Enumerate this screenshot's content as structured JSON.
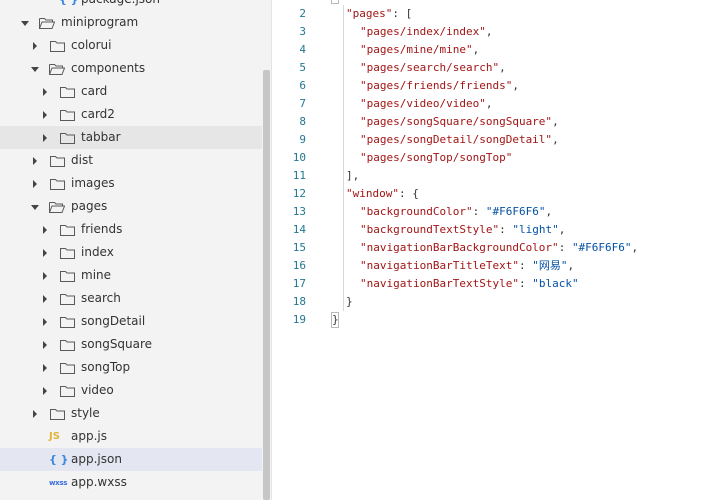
{
  "explorer": {
    "items": [
      {
        "label": "package.json",
        "kind": "file",
        "file_type": "json",
        "depth": 2,
        "badge": "{ }"
      },
      {
        "label": "miniprogram",
        "kind": "folder",
        "expanded": true,
        "depth": 0
      },
      {
        "label": "colorui",
        "kind": "folder",
        "expanded": false,
        "depth": 1
      },
      {
        "label": "components",
        "kind": "folder",
        "expanded": true,
        "depth": 1
      },
      {
        "label": "card",
        "kind": "folder",
        "expanded": false,
        "depth": 2
      },
      {
        "label": "card2",
        "kind": "folder",
        "expanded": false,
        "depth": 2
      },
      {
        "label": "tabbar",
        "kind": "folder",
        "expanded": false,
        "depth": 2,
        "hovered": true
      },
      {
        "label": "dist",
        "kind": "folder",
        "expanded": false,
        "depth": 1
      },
      {
        "label": "images",
        "kind": "folder",
        "expanded": false,
        "depth": 1
      },
      {
        "label": "pages",
        "kind": "folder",
        "expanded": true,
        "depth": 1
      },
      {
        "label": "friends",
        "kind": "folder",
        "expanded": false,
        "depth": 2
      },
      {
        "label": "index",
        "kind": "folder",
        "expanded": false,
        "depth": 2
      },
      {
        "label": "mine",
        "kind": "folder",
        "expanded": false,
        "depth": 2
      },
      {
        "label": "search",
        "kind": "folder",
        "expanded": false,
        "depth": 2
      },
      {
        "label": "songDetail",
        "kind": "folder",
        "expanded": false,
        "depth": 2
      },
      {
        "label": "songSquare",
        "kind": "folder",
        "expanded": false,
        "depth": 2
      },
      {
        "label": "songTop",
        "kind": "folder",
        "expanded": false,
        "depth": 2
      },
      {
        "label": "video",
        "kind": "folder",
        "expanded": false,
        "depth": 2
      },
      {
        "label": "style",
        "kind": "folder",
        "expanded": false,
        "depth": 1
      },
      {
        "label": "app.js",
        "kind": "file",
        "file_type": "js",
        "depth": 1,
        "badge": "JS"
      },
      {
        "label": "app.json",
        "kind": "file",
        "file_type": "json",
        "depth": 1,
        "badge": "{ }",
        "selected": true
      },
      {
        "label": "app.wxss",
        "kind": "file",
        "file_type": "wxss",
        "depth": 1,
        "badge": "wxss"
      }
    ]
  },
  "editor": {
    "lines": [
      {
        "n": "2",
        "indent": 1,
        "tokens": [
          [
            "key",
            "\"pages\""
          ],
          [
            "punc",
            ": ["
          ]
        ]
      },
      {
        "n": "3",
        "indent": 2,
        "tokens": [
          [
            "key",
            "\"pages/index/index\""
          ],
          [
            "punc",
            ","
          ]
        ]
      },
      {
        "n": "4",
        "indent": 2,
        "tokens": [
          [
            "key",
            "\"pages/mine/mine\""
          ],
          [
            "punc",
            ","
          ]
        ]
      },
      {
        "n": "5",
        "indent": 2,
        "tokens": [
          [
            "key",
            "\"pages/search/search\""
          ],
          [
            "punc",
            ","
          ]
        ]
      },
      {
        "n": "6",
        "indent": 2,
        "tokens": [
          [
            "key",
            "\"pages/friends/friends\""
          ],
          [
            "punc",
            ","
          ]
        ]
      },
      {
        "n": "7",
        "indent": 2,
        "tokens": [
          [
            "key",
            "\"pages/video/video\""
          ],
          [
            "punc",
            ","
          ]
        ]
      },
      {
        "n": "8",
        "indent": 2,
        "tokens": [
          [
            "key",
            "\"pages/songSquare/songSquare\""
          ],
          [
            "punc",
            ","
          ]
        ]
      },
      {
        "n": "9",
        "indent": 2,
        "tokens": [
          [
            "key",
            "\"pages/songDetail/songDetail\""
          ],
          [
            "punc",
            ","
          ]
        ]
      },
      {
        "n": "10",
        "indent": 2,
        "tokens": [
          [
            "key",
            "\"pages/songTop/songTop\""
          ]
        ]
      },
      {
        "n": "11",
        "indent": 1,
        "tokens": [
          [
            "punc",
            "],"
          ]
        ]
      },
      {
        "n": "12",
        "indent": 1,
        "tokens": [
          [
            "key",
            "\"window\""
          ],
          [
            "punc",
            ": {"
          ]
        ]
      },
      {
        "n": "13",
        "indent": 2,
        "tokens": [
          [
            "key",
            "\"backgroundColor\""
          ],
          [
            "punc",
            ": "
          ],
          [
            "str",
            "\"#F6F6F6\""
          ],
          [
            "punc",
            ","
          ]
        ]
      },
      {
        "n": "14",
        "indent": 2,
        "tokens": [
          [
            "key",
            "\"backgroundTextStyle\""
          ],
          [
            "punc",
            ": "
          ],
          [
            "str",
            "\"light\""
          ],
          [
            "punc",
            ","
          ]
        ]
      },
      {
        "n": "15",
        "indent": 2,
        "tokens": [
          [
            "key",
            "\"navigationBarBackgroundColor\""
          ],
          [
            "punc",
            ": "
          ],
          [
            "str",
            "\"#F6F6F6\""
          ],
          [
            "punc",
            ","
          ]
        ]
      },
      {
        "n": "16",
        "indent": 2,
        "tokens": [
          [
            "key",
            "\"navigationBarTitleText\""
          ],
          [
            "punc",
            ": "
          ],
          [
            "str",
            "\"网易\""
          ],
          [
            "punc",
            ","
          ]
        ]
      },
      {
        "n": "17",
        "indent": 2,
        "tokens": [
          [
            "key",
            "\"navigationBarTextStyle\""
          ],
          [
            "punc",
            ": "
          ],
          [
            "str",
            "\"black\""
          ]
        ]
      },
      {
        "n": "18",
        "indent": 1,
        "tokens": [
          [
            "punc",
            "}"
          ]
        ]
      },
      {
        "n": "19",
        "indent": 0,
        "tokens": [
          [
            "punc",
            "}"
          ]
        ]
      }
    ]
  },
  "colors": {
    "folder_icon": "#5a5a5a",
    "line_number": "#237893",
    "json_key": "#a31515",
    "json_string": "#0451a5",
    "selected_row": "#e4e6f1"
  },
  "icons": {
    "folder_closed": "folder-icon",
    "folder_open": "folder-open-icon",
    "twisty_collapsed": "chevron-right-icon",
    "twisty_expanded": "chevron-down-icon"
  }
}
